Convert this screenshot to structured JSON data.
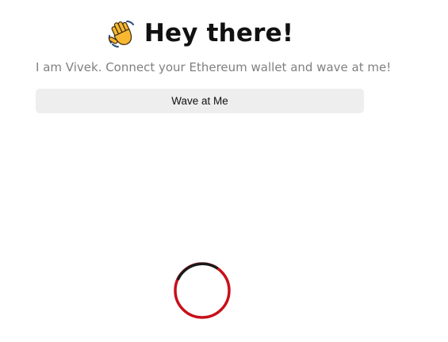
{
  "header": {
    "icon": "waving-hand-icon",
    "title": "Hey there!"
  },
  "bio": {
    "text": "I am Vivek. Connect your Ethereum wallet and wave at me!"
  },
  "actions": {
    "wave_label": "Wave at Me"
  },
  "loader": {
    "icon": "loading-spinner-icon",
    "colors": {
      "track": "#c8101a",
      "arc": "#1a1a1a"
    }
  }
}
